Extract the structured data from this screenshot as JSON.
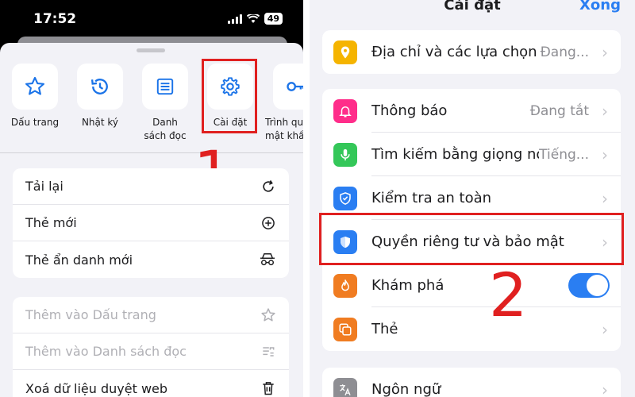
{
  "left_phone": {
    "status": {
      "time": "17:52",
      "battery": "49"
    },
    "shortcuts": [
      {
        "label": "Dấu trang",
        "icon": "star-icon"
      },
      {
        "label": "Nhật ký",
        "icon": "history-icon"
      },
      {
        "label": "Danh sách đọc",
        "icon": "reading-list-icon"
      },
      {
        "label": "Cài đặt",
        "icon": "gear-icon"
      },
      {
        "label": "Trình quản lý mật khẩu",
        "icon": "key-icon"
      }
    ],
    "menu_group_1": [
      {
        "label": "Tải lại",
        "icon": "reload-icon"
      },
      {
        "label": "Thẻ mới",
        "icon": "plus-circle-icon"
      },
      {
        "label": "Thẻ ẩn danh mới",
        "icon": "incognito-icon"
      }
    ],
    "menu_group_2": [
      {
        "label": "Thêm vào Dấu trang",
        "icon": "star-icon"
      },
      {
        "label": "Thêm vào Danh sách đọc",
        "icon": "reading-list-add-icon"
      },
      {
        "label": "Xoá dữ liệu duyệt web",
        "icon": "trash-icon"
      }
    ],
    "step_number": "1"
  },
  "right_phone": {
    "title": "Cài đặt",
    "done_label": "Xong",
    "top_row": {
      "label": "Địa chỉ và các lựa chọn khác",
      "value": "Đang...",
      "icon": "location-pin-icon",
      "color": "#f5b400"
    },
    "main_group": [
      {
        "label": "Thông báo",
        "value": "Đang tắt",
        "icon": "bell-icon",
        "color": "#ff2d8a"
      },
      {
        "label": "Tìm kiếm bằng giọng nói",
        "value": "Tiếng...",
        "icon": "microphone-icon",
        "color": "#34c759"
      },
      {
        "label": "Kiểm tra an toàn",
        "value": "",
        "icon": "shield-check-icon",
        "color": "#2a7ef2"
      },
      {
        "label": "Quyền riêng tư và bảo mật",
        "value": "",
        "icon": "shield-icon",
        "color": "#2a7ef2"
      },
      {
        "label": "Khám phá",
        "value": "",
        "icon": "flame-icon",
        "color": "#f07c21",
        "toggle_on": true
      },
      {
        "label": "Thẻ",
        "value": "",
        "icon": "tabs-icon",
        "color": "#f07c21"
      }
    ],
    "bottom_row": {
      "label": "Ngôn ngữ",
      "icon": "translate-icon",
      "color": "#8e8e93"
    },
    "step_number": "2"
  },
  "colors": {
    "accent": "#2a7ef2",
    "highlight": "#e02020"
  }
}
